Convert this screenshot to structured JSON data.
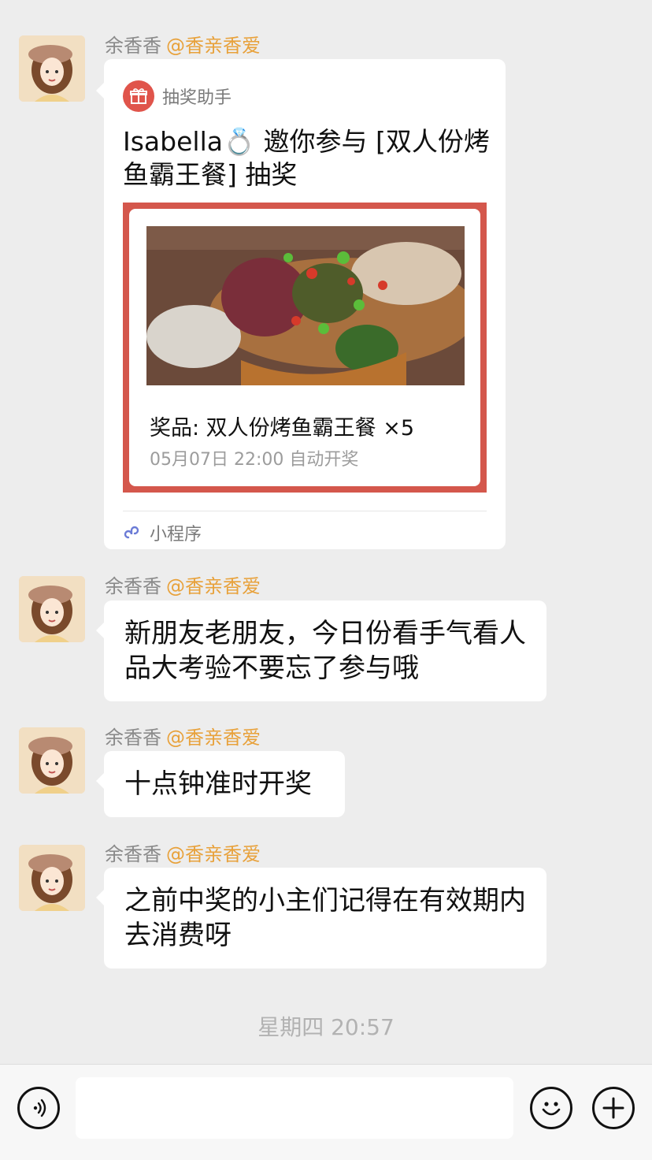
{
  "messages": [
    {
      "sender": "余香香",
      "tag": "@香亲香爱",
      "card": {
        "app_name": "抽奖助手",
        "title": "Isabella💍 邀你参与 [双人份烤鱼霸王餐] 抽奖",
        "prize": "奖品: 双人份烤鱼霸王餐  ×5",
        "draw_time": "05月07日 22:00 自动开奖",
        "footer": "小程序"
      }
    },
    {
      "sender": "余香香",
      "tag": "@香亲香爱",
      "text": "新朋友老朋友，今日份看手气看人品大考验不要忘了参与哦"
    },
    {
      "sender": "余香香",
      "tag": "@香亲香爱",
      "text": "十点钟准时开奖"
    },
    {
      "sender": "余香香",
      "tag": "@香亲香爱",
      "text": "之前中奖的小主们记得在有效期内去消费呀"
    }
  ],
  "timestamp": "星期四 20:57",
  "input": {
    "value": ""
  },
  "colors": {
    "accent_tag": "#e8a13a",
    "card_frame": "#d4574c",
    "background": "#ededed"
  },
  "icons": {
    "voice": "voice-icon",
    "emoji": "emoji-icon",
    "plus": "plus-icon",
    "gift": "gift-icon",
    "mini_program": "mini-program-icon"
  }
}
